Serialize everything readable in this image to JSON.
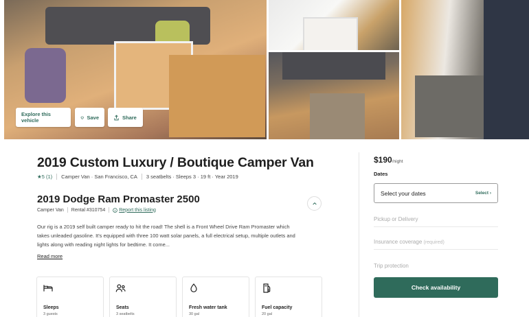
{
  "gallery": {
    "explore_label": "Explore this vehicle",
    "save_label": "Save",
    "share_label": "Share"
  },
  "listing": {
    "title": "2019 Custom Luxury / Boutique Camper Van",
    "rating": "5",
    "review_count": "(1)",
    "type_location": "Camper Van · San Francisco, CA",
    "specs": "3 seatbelts · Sleeps 3 · 19 ft · Year 2019",
    "vehicle_name": "2019 Dodge Ram Promaster 2500",
    "vehicle_type": "Camper Van",
    "rental_id": "Rental #310754",
    "report_label": "Report this listing",
    "description": "Our rig is a 2019 self built camper ready to hit the road! The shell is a Front Wheel Drive Ram Promaster which takes unleaded gasoline. It's equipped with three 100 watt solar panels, a full electrical setup, multiple outlets and lights along with reading night lights for bedtime. It come...",
    "read_more": "Read more"
  },
  "features": [
    {
      "name": "Sleeps",
      "value": "3 guests",
      "icon": "bed-icon"
    },
    {
      "name": "Seats",
      "value": "3 seatbelts",
      "icon": "people-icon"
    },
    {
      "name": "Fresh water tank",
      "value": "30 gal",
      "icon": "water-drop-icon"
    },
    {
      "name": "Fuel capacity",
      "value": "20 gal",
      "icon": "fuel-icon"
    }
  ],
  "booking": {
    "price": "$190",
    "price_unit": "/night",
    "dates_label": "Dates",
    "dates_placeholder": "Select your dates",
    "select_label": "Select",
    "pickup_label": "Pickup or Delivery",
    "insurance_label": "Insurance coverage",
    "insurance_note": "(required)",
    "trip_protection_label": "Trip protection",
    "check_label": "Check availability"
  },
  "colors": {
    "accent": "#2f6b5b"
  }
}
